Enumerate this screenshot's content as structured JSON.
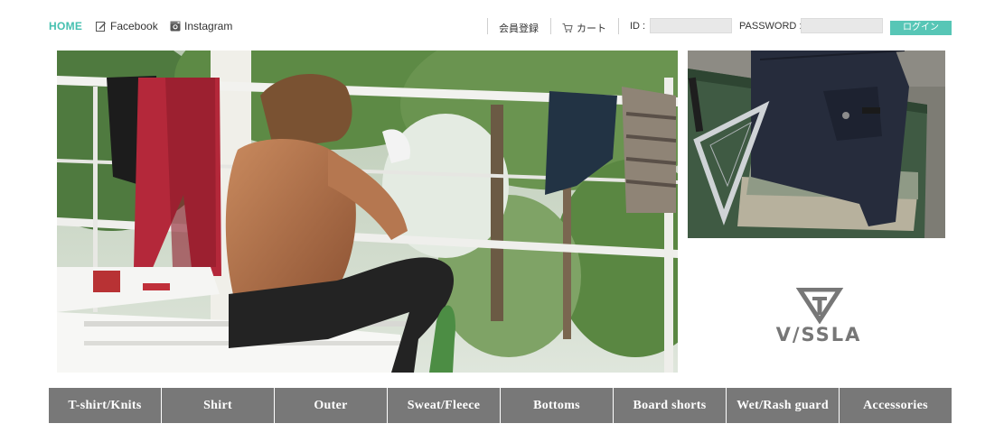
{
  "header": {
    "home": "HOME",
    "facebook": "Facebook",
    "instagram": "Instagram",
    "register": "会員登録",
    "cart": "カート",
    "id_label": "ID :",
    "id_value": "",
    "password_label": "PASSWORD :",
    "password_value": "",
    "login": "ログイン"
  },
  "brand": {
    "name": "V/SSLA"
  },
  "categories": [
    "T-shirt/Knits",
    "Shirt",
    "Outer",
    "Sweat/Fleece",
    "Bottoms",
    "Board shorts",
    "Wet/Rash guard",
    "Accessories"
  ],
  "colors": {
    "accent": "#45c0b0",
    "login_button": "#57c6b6",
    "category_bg": "#787878"
  }
}
